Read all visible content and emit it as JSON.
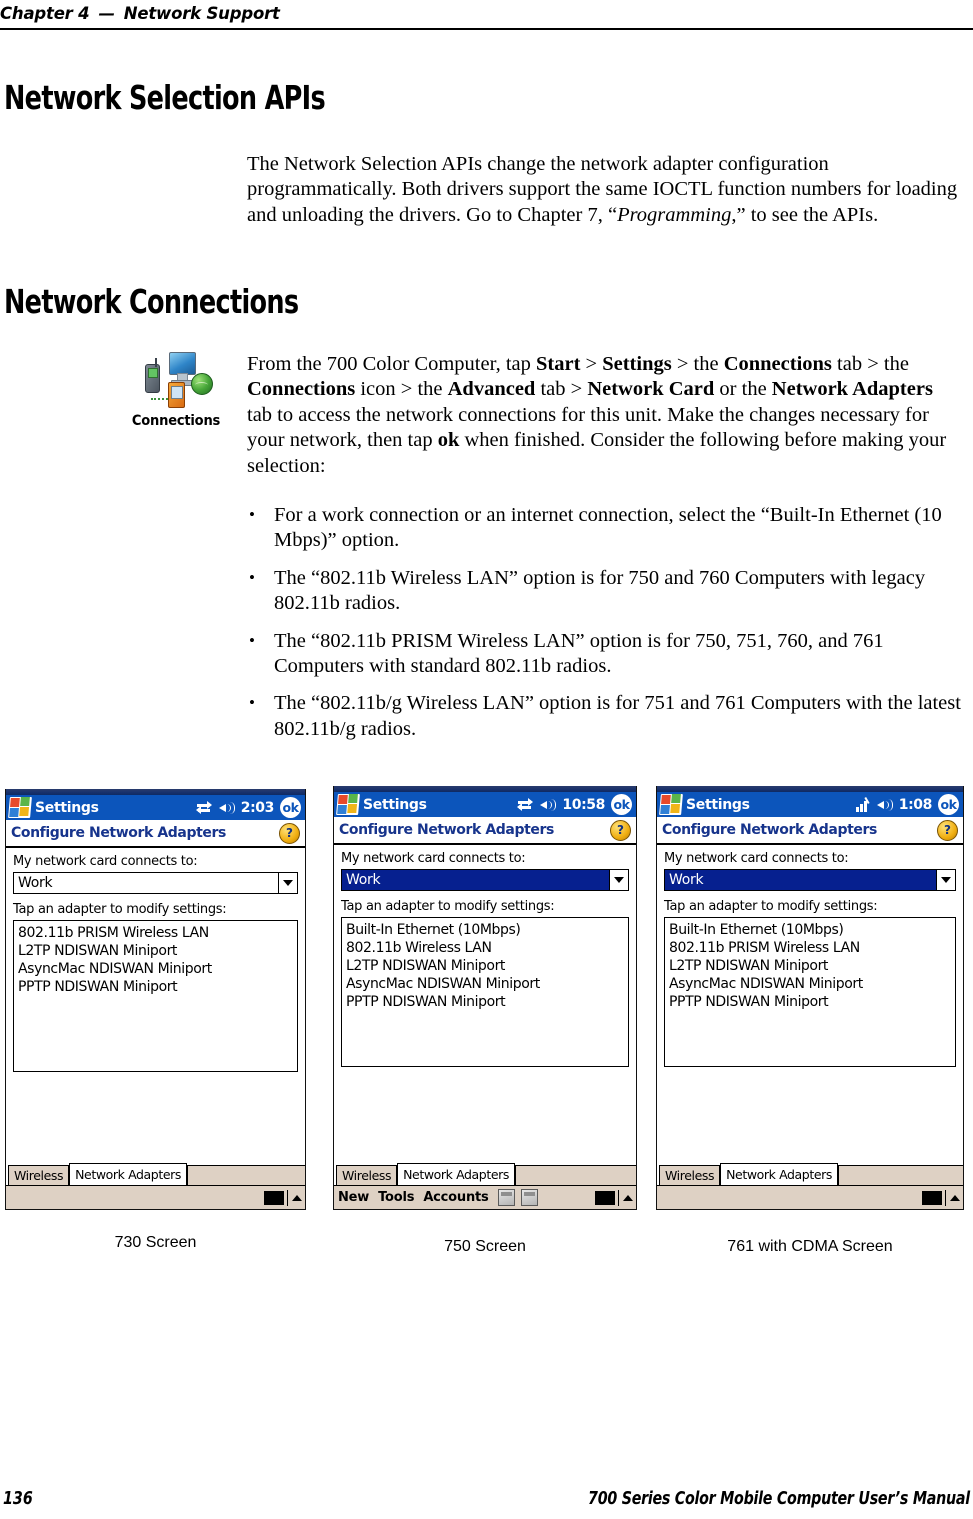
{
  "running_head": {
    "chapter": "Chapter 4",
    "dash": "—",
    "title": "Network Support"
  },
  "headings": {
    "network_selection_apis": "Network Selection APIs",
    "network_connections": "Network Connections"
  },
  "paragraphs": {
    "intro": {
      "part1": "The Network Selection APIs change the network adapter configuration programmatically. Both drivers support the same IOCTL function numbers for loading and unloading the drivers. Go to Chapter 7, “",
      "italic1": "Programming",
      "part2": ",” to see the APIs."
    },
    "main": {
      "p1": "From the 700 Color Computer, tap ",
      "b1": "Start",
      "p2": " > ",
      "b2": "Settings",
      "p3": " > the ",
      "b3": "Connections",
      "p4": " tab > the ",
      "b4": "Connections",
      "p5": " icon > the ",
      "b5": "Advanced",
      "p6": " tab > ",
      "b6": "Network Card",
      "p7": " or the ",
      "b7": "Network Adapters",
      "p8": " tab to access the network connections for this unit. Make the changes necessary for your network, then tap ",
      "b8": "ok",
      "p9": " when finished. Consider the following before making your selection:"
    }
  },
  "bullets": [
    "For a work connection or an internet connection, select the “Built-In Ethernet (10 Mbps)” option.",
    "The “802.11b Wireless LAN” option is for 750 and 760 Computers with legacy 802.11b radios.",
    "The “802.11b PRISM Wireless LAN” option is for 750, 751, 760, and 761 Computers with standard 802.11b radios.",
    "The “802.11b/g Wireless LAN” option is for 751 and 761 Computers with the latest 802.11b/g radios."
  ],
  "connections_icon": {
    "label": "Connections"
  },
  "screenshots": [
    {
      "caption": "730 Screen",
      "titlebar": {
        "app": "Settings",
        "clock": "2:03",
        "ok_label": "ok",
        "status_icon": "connectivity-icon",
        "volume_icon": "speaker-icon"
      },
      "subtitle": "Configure Network Adapters",
      "help_glyph": "?",
      "field_label": "My network card connects to:",
      "combo_value": "Work",
      "combo_selected": false,
      "list_label": "Tap an adapter to modify settings:",
      "adapters": [
        "802.11b PRISM Wireless LAN",
        "L2TP NDISWAN Miniport",
        "AsyncMac NDISWAN Miniport",
        "PPTP NDISWAN Miniport"
      ],
      "tabs": [
        {
          "label": "Wireless",
          "active": false
        },
        {
          "label": "Network Adapters",
          "active": true
        }
      ],
      "menubar": null
    },
    {
      "caption": "750 Screen",
      "titlebar": {
        "app": "Settings",
        "clock": "10:58",
        "ok_label": "ok",
        "status_icon": "connectivity-icon",
        "volume_icon": "speaker-icon"
      },
      "subtitle": "Configure Network Adapters",
      "help_glyph": "?",
      "field_label": "My network card connects to:",
      "combo_value": "Work",
      "combo_selected": true,
      "list_label": "Tap an adapter to modify settings:",
      "adapters": [
        "Built-In Ethernet (10Mbps)",
        "802.11b Wireless LAN",
        "L2TP NDISWAN Miniport",
        "AsyncMac NDISWAN Miniport",
        "PPTP NDISWAN Miniport"
      ],
      "tabs": [
        {
          "label": "Wireless",
          "active": false
        },
        {
          "label": "Network Adapters",
          "active": true
        }
      ],
      "menubar": {
        "items": [
          "New",
          "Tools",
          "Accounts"
        ],
        "icons": [
          "save-icon",
          "copy-icon"
        ]
      }
    },
    {
      "caption": "761 with CDMA Screen",
      "titlebar": {
        "app": "Settings",
        "clock": "1:08",
        "ok_label": "ok",
        "status_icon": "signal-bars-icon",
        "volume_icon": "speaker-icon"
      },
      "subtitle": "Configure Network Adapters",
      "help_glyph": "?",
      "field_label": "My network card connects to:",
      "combo_value": "Work",
      "combo_selected": true,
      "list_label": "Tap an adapter to modify settings:",
      "adapters": [
        "Built-In Ethernet (10Mbps)",
        "802.11b PRISM Wireless LAN",
        "L2TP NDISWAN Miniport",
        "AsyncMac NDISWAN Miniport",
        "PPTP NDISWAN Miniport"
      ],
      "tabs": [
        {
          "label": "Wireless",
          "active": false
        },
        {
          "label": "Network Adapters",
          "active": true
        }
      ],
      "menubar": null
    }
  ],
  "footer": {
    "page_number": "136",
    "manual_title": "700 Series Color Mobile Computer User’s Manual"
  },
  "colors": {
    "titlebar_blue": "#0c55bb",
    "subtitle_blue": "#17348c",
    "selection_blue": "#06208f",
    "toolbar_beige": "#ded1c4"
  }
}
